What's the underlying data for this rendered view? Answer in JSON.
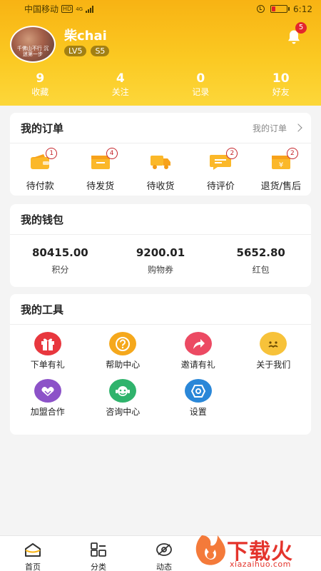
{
  "status_bar": {
    "carrier": "中国移动",
    "hd": "HD",
    "network": "4G",
    "time": "6:12"
  },
  "profile": {
    "avatar_caption": "千佛山不行 沉迷第一步",
    "name": "柴chai",
    "level": "LV5",
    "rank": "S5",
    "notifications": "5"
  },
  "stats": [
    {
      "value": "9",
      "label": "收藏"
    },
    {
      "value": "4",
      "label": "关注"
    },
    {
      "value": "0",
      "label": "记录"
    },
    {
      "value": "10",
      "label": "好友"
    }
  ],
  "orders": {
    "title": "我的订单",
    "more": "我的订单",
    "items": [
      {
        "label": "待付款",
        "count": "1",
        "icon": "wallet-icon"
      },
      {
        "label": "待发货",
        "count": "4",
        "icon": "package-icon"
      },
      {
        "label": "待收货",
        "count": "",
        "icon": "truck-icon"
      },
      {
        "label": "待评价",
        "count": "2",
        "icon": "comment-icon"
      },
      {
        "label": "退货/售后",
        "count": "2",
        "icon": "refund-icon"
      }
    ]
  },
  "wallet": {
    "title": "我的钱包",
    "items": [
      {
        "value": "80415.00",
        "label": "积分"
      },
      {
        "value": "9200.01",
        "label": "购物券"
      },
      {
        "value": "5652.80",
        "label": "红包"
      }
    ]
  },
  "tools": {
    "title": "我的工具",
    "items": [
      {
        "label": "下单有礼",
        "icon": "gift-icon",
        "color": "#e8373e"
      },
      {
        "label": "帮助中心",
        "icon": "help-icon",
        "color": "#f5a81c"
      },
      {
        "label": "邀请有礼",
        "icon": "share-icon",
        "color": "#ec4a63"
      },
      {
        "label": "关于我们",
        "icon": "about-icon",
        "color": "#f7c23a"
      },
      {
        "label": "加盟合作",
        "icon": "handshake-icon",
        "color": "#8c52c8"
      },
      {
        "label": "咨询中心",
        "icon": "consult-icon",
        "color": "#2fb36c"
      },
      {
        "label": "设置",
        "icon": "settings-icon",
        "color": "#2a87d8"
      }
    ]
  },
  "tabbar": [
    {
      "label": "首页",
      "icon": "home-icon"
    },
    {
      "label": "分类",
      "icon": "category-icon"
    },
    {
      "label": "动态",
      "icon": "feed-icon"
    }
  ],
  "watermark": {
    "text": "下载火",
    "url": "xiazaihuo.com"
  },
  "colors": {
    "accent": "#fbc922",
    "badge_red": "#e3262e"
  }
}
